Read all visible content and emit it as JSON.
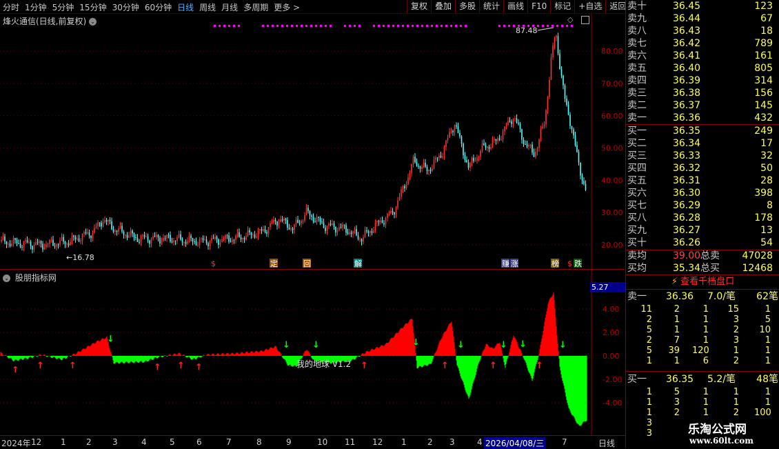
{
  "toolbar": {
    "periods": [
      "分时",
      "1分钟",
      "5分钟",
      "15分钟",
      "30分钟",
      "60分钟",
      "日线",
      "周线",
      "月线",
      "多周期",
      "更多 >"
    ],
    "active_period": "日线",
    "buttons": [
      "复权",
      "叠加",
      "多股",
      "统计",
      "画线",
      "F10",
      "标记",
      "+自选",
      "返回"
    ]
  },
  "main_chart": {
    "title": "烽火通信(日线,前复权)",
    "y_ticks": [
      "80.00",
      "70.00",
      "60.00",
      "50.00",
      "40.00",
      "30.00",
      "20.00"
    ],
    "high_label": "87.48",
    "low_label": "16.78",
    "signal_labels": [
      "$",
      "定",
      "回",
      "解",
      "赚",
      "涨",
      "榜",
      "$",
      "跌"
    ],
    "colors": {
      "up": "#ff3232",
      "down": "#54ffff",
      "magenta": "#ff00ff"
    }
  },
  "indicator": {
    "title": "股朋指标网",
    "y_ticks": [
      "4.00",
      "2.00",
      "0.00",
      "-2.00",
      "-4.00"
    ],
    "current_value": "5.27",
    "watermark": "我的地球 V1.2",
    "colors": {
      "positive": "#ff0000",
      "negative": "#00ff00"
    }
  },
  "date_axis": {
    "labels": [
      "2024年",
      "12",
      "1",
      "2",
      "3",
      "4",
      "5",
      "6",
      "7",
      "8",
      "9",
      "10",
      "11",
      "12",
      "1",
      "2",
      "3",
      "4",
      "7"
    ],
    "highlight": "2026/04/08/三",
    "period": "日线"
  },
  "order_book": {
    "asks": [
      {
        "label": "卖十",
        "price": "36.45",
        "vol": "123"
      },
      {
        "label": "卖九",
        "price": "36.44",
        "vol": "67"
      },
      {
        "label": "卖八",
        "price": "36.43",
        "vol": "18"
      },
      {
        "label": "卖七",
        "price": "36.42",
        "vol": "789"
      },
      {
        "label": "卖六",
        "price": "36.41",
        "vol": "161"
      },
      {
        "label": "卖五",
        "price": "36.40",
        "vol": "805"
      },
      {
        "label": "卖四",
        "price": "36.39",
        "vol": "314"
      },
      {
        "label": "卖三",
        "price": "36.38",
        "vol": "156"
      },
      {
        "label": "卖二",
        "price": "36.37",
        "vol": "145"
      },
      {
        "label": "卖一",
        "price": "36.36",
        "vol": "432"
      }
    ],
    "bids": [
      {
        "label": "买一",
        "price": "36.35",
        "vol": "249"
      },
      {
        "label": "买二",
        "price": "36.34",
        "vol": "17"
      },
      {
        "label": "买三",
        "price": "36.33",
        "vol": "32"
      },
      {
        "label": "买四",
        "price": "36.32",
        "vol": "50"
      },
      {
        "label": "买五",
        "price": "36.31",
        "vol": "28"
      },
      {
        "label": "买六",
        "price": "36.30",
        "vol": "398"
      },
      {
        "label": "买七",
        "price": "36.29",
        "vol": "8"
      },
      {
        "label": "买八",
        "price": "36.28",
        "vol": "178"
      },
      {
        "label": "买九",
        "price": "36.27",
        "vol": "13"
      },
      {
        "label": "买十",
        "price": "36.26",
        "vol": "54"
      }
    ],
    "summary": [
      {
        "label": "卖均",
        "price": "39.00",
        "label2": "总卖",
        "vol": "47028"
      },
      {
        "label": "买均",
        "price": "35.34",
        "label2": "总买",
        "vol": "12468"
      }
    ],
    "view_thousand": "查看千档盘口",
    "sell_queue": {
      "label": "卖一",
      "price": "36.36",
      "per": "7.0/笔",
      "count": "62笔",
      "rows": [
        [
          "11",
          "2",
          "1",
          "15",
          "1"
        ],
        [
          "2",
          "1",
          "1",
          "3",
          "5"
        ],
        [
          "5",
          "1",
          "1",
          "2",
          "10"
        ],
        [
          "2",
          "7",
          "1",
          "3",
          "1"
        ],
        [
          "5",
          "39",
          "120",
          "1",
          "1"
        ],
        [
          "1",
          "1",
          "6",
          "2",
          "1"
        ]
      ]
    },
    "buy_queue": {
      "label": "买一",
      "price": "36.35",
      "per": "5.2/笔",
      "count": "48笔",
      "rows": [
        [
          "1",
          "5",
          "1",
          "1",
          "1"
        ],
        [
          "1",
          "3",
          "1",
          "1",
          "1"
        ],
        [
          "1",
          "2",
          "1",
          "2",
          "100"
        ],
        [
          "3",
          "",
          "",
          "",
          ""
        ],
        [
          "3",
          "",
          "",
          "",
          ""
        ]
      ]
    }
  },
  "brand": {
    "name": "乐淘公式网",
    "url": "www.60lt.com"
  }
}
